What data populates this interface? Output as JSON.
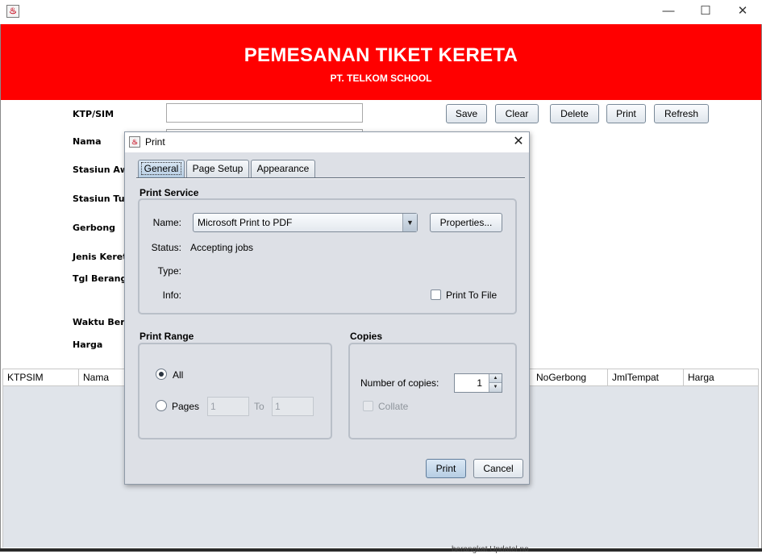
{
  "window": {
    "title": "",
    "controls": {
      "minimize": "—",
      "maximize": "☐",
      "close": "✕"
    }
  },
  "header": {
    "title": "PEMESANAN TIKET KERETA",
    "subtitle": "PT. TELKOM SCHOOL",
    "background_color": "#ff0000"
  },
  "form": {
    "labels": [
      "KTP/SIM",
      "Nama",
      "Stasiun Awa",
      "Stasiun Tuj",
      "Gerbong",
      "Jenis Keret",
      "Tgl Berangk",
      "Waktu Bera",
      "Harga"
    ],
    "ktp_value": ""
  },
  "toolbar": {
    "save": "Save",
    "clear": "Clear",
    "delete": "Delete",
    "print": "Print",
    "refresh": "Refresh"
  },
  "table": {
    "columns": [
      "KTPSIM",
      "Nama",
      "NoGerbong",
      "JmlTempat",
      "Harga"
    ]
  },
  "taskbar_text": "berangkat Updatel no",
  "print_dialog": {
    "title": "Print",
    "close": "✕",
    "tabs": [
      {
        "label": "General",
        "active": true
      },
      {
        "label": "Page Setup",
        "active": false
      },
      {
        "label": "Appearance",
        "active": false
      }
    ],
    "print_service": {
      "heading": "Print Service",
      "name_label": "Name:",
      "printer": "Microsoft Print to PDF",
      "properties_button": "Properties...",
      "status_label": "Status:",
      "status_value": "Accepting jobs",
      "type_label": "Type:",
      "type_value": "",
      "info_label": "Info:",
      "info_value": "",
      "print_to_file_label": "Print To File",
      "print_to_file_checked": false
    },
    "print_range": {
      "heading": "Print Range",
      "all_label": "All",
      "all_selected": true,
      "pages_label": "Pages",
      "pages_from": "1",
      "to_label": "To",
      "pages_to": "1"
    },
    "copies": {
      "heading": "Copies",
      "number_label": "Number of copies:",
      "number_value": "1",
      "collate_label": "Collate",
      "collate_checked": false
    },
    "buttons": {
      "print": "Print",
      "cancel": "Cancel"
    }
  }
}
